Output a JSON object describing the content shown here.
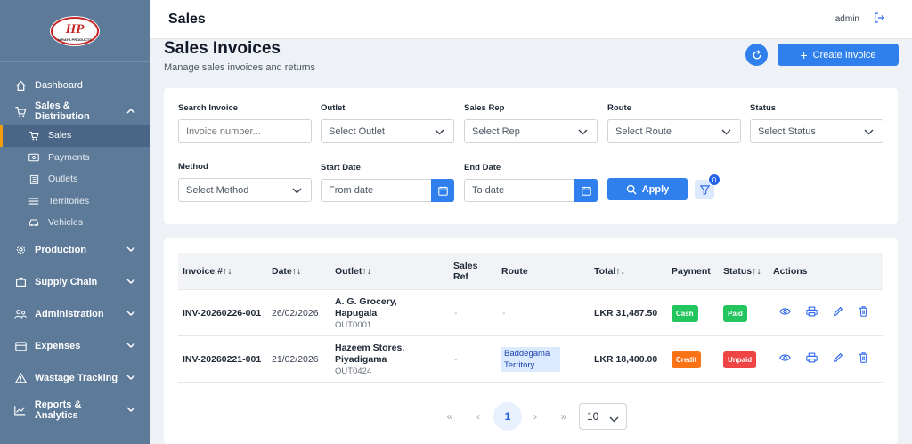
{
  "sidebar": {
    "logo_text": "HP HIRAYA PRODUCTS",
    "items": {
      "dashboard": "Dashboard",
      "sales_distribution": "Sales & Distribution",
      "sales": "Sales",
      "payments": "Payments",
      "outlets": "Outlets",
      "territories": "Territories",
      "vehicles": "Vehicles",
      "production": "Production",
      "supply_chain": "Supply Chain",
      "administration": "Administration",
      "expenses": "Expenses",
      "wastage": "Wastage Tracking",
      "reports": "Reports & Analytics"
    },
    "accent": "#f59e0b",
    "bg": "#5d7a99"
  },
  "header": {
    "title": "Sales",
    "user": "admin"
  },
  "page": {
    "title": "Sales Invoices",
    "subtitle": "Manage sales invoices and returns",
    "create_label": "Create Invoice"
  },
  "filters": {
    "search": {
      "label": "Search Invoice",
      "placeholder": "Invoice number..."
    },
    "outlet": {
      "label": "Outlet",
      "value": "Select Outlet"
    },
    "sales_rep": {
      "label": "Sales Rep",
      "value": "Select Rep"
    },
    "route": {
      "label": "Route",
      "value": "Select Route"
    },
    "status": {
      "label": "Status",
      "value": "Select Status"
    },
    "method": {
      "label": "Method",
      "value": "Select Method"
    },
    "start_date": {
      "label": "Start Date",
      "placeholder": "From date"
    },
    "end_date": {
      "label": "End Date",
      "placeholder": "To date"
    },
    "apply_label": "Apply",
    "active_count": "0"
  },
  "table": {
    "headers": {
      "invoice": "Invoice #↑↓",
      "date": "Date↑↓",
      "outlet": "Outlet↑↓",
      "sales_ref": "Sales Ref",
      "route": "Route",
      "total": "Total↑↓",
      "payment": "Payment",
      "status": "Status↑↓",
      "actions": "Actions"
    },
    "rows": [
      {
        "invoice": "INV-20260226-001",
        "date": "26/02/2026",
        "outlet_name": "A. G. Grocery, Hapugala",
        "outlet_code": "OUT0001",
        "sales_ref": "-",
        "route": "-",
        "total": "LKR 31,487.50",
        "payment": "Cash",
        "payment_color": "#22c55e",
        "status": "Paid",
        "status_color": "#22c55e"
      },
      {
        "invoice": "INV-20260221-001",
        "date": "21/02/2026",
        "outlet_name": "Hazeem Stores, Piyadigama",
        "outlet_code": "OUT0424",
        "sales_ref": "-",
        "route": "Baddegama Territory",
        "total": "LKR 18,400.00",
        "payment": "Credit",
        "payment_color": "#f97316",
        "status": "Unpaid",
        "status_color": "#ef4444"
      }
    ]
  },
  "pagination": {
    "first": "«",
    "prev": "‹",
    "current": "1",
    "next": "›",
    "last": "»",
    "page_size": "10"
  }
}
